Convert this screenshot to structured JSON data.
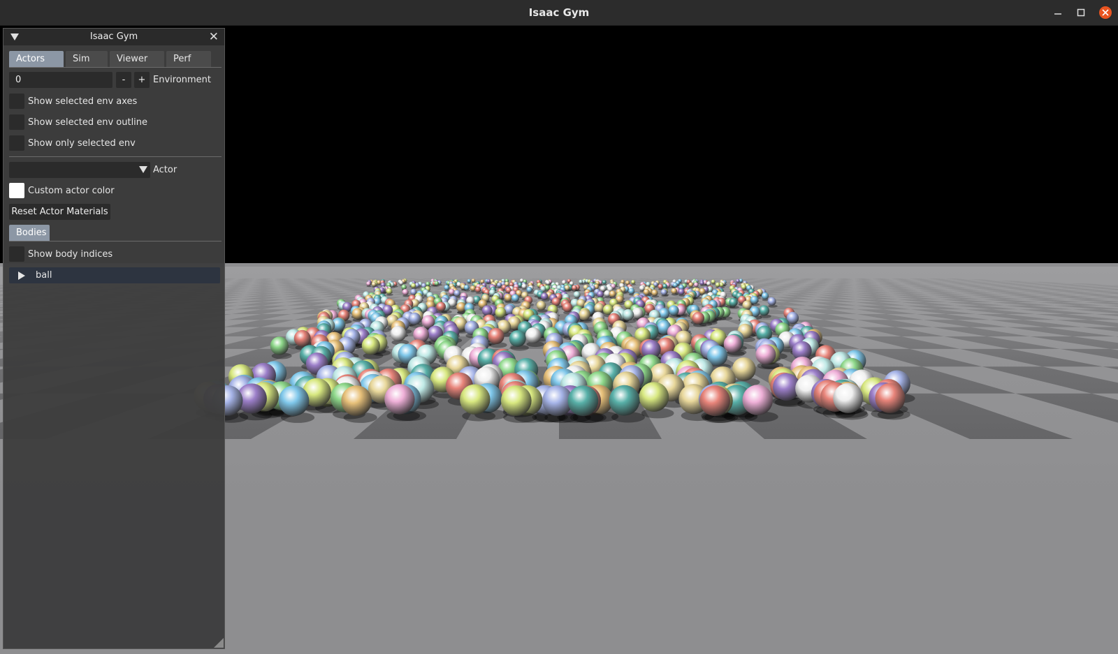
{
  "window": {
    "title": "Isaac Gym"
  },
  "panel": {
    "title": "Isaac Gym",
    "tabs": [
      "Actors",
      "Sim",
      "Viewer",
      "Perf"
    ],
    "environment": {
      "value": "0",
      "minus": "-",
      "plus": "+",
      "label": "Environment"
    },
    "checks": [
      "Show selected env axes",
      "Show selected env outline",
      "Show only selected env"
    ],
    "actor": {
      "label": "Actor",
      "value": ""
    },
    "custom_color_label": "Custom actor color",
    "reset_label": "Reset Actor Materials",
    "bodies_tab": "Bodies",
    "body_indices_label": "Show body indices",
    "tree_item": "ball"
  },
  "colors": {
    "accent_tab": "#8c97a5",
    "close_button": "#e95420",
    "sky": "#000000",
    "floor_light": "#8e8e90",
    "floor_dark": "#5c5c5e",
    "ball_palette": [
      "#e8d79a",
      "#bfe9e6",
      "#9c7fc9",
      "#7fc7ea",
      "#e8847a",
      "#8ed88a",
      "#efb0d8",
      "#f0f0f0",
      "#58b0a8",
      "#e8c17a",
      "#a6b4e8",
      "#d8e880"
    ]
  }
}
